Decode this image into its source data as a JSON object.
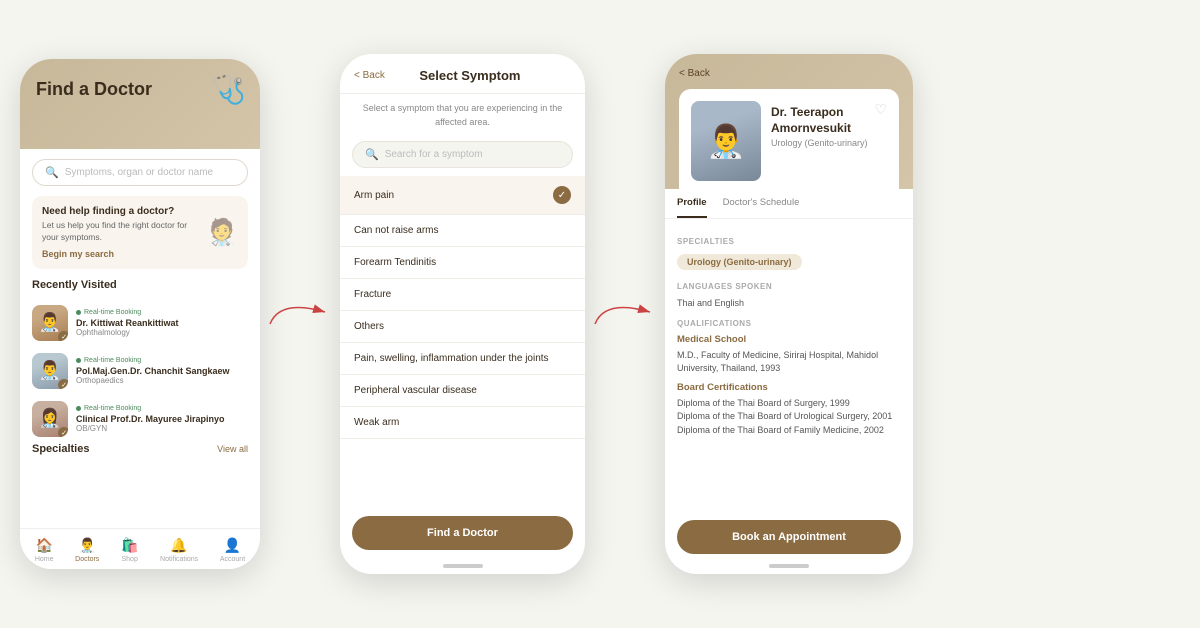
{
  "screen1": {
    "title": "Find a Doctor",
    "search_placeholder": "Symptoms, organ or doctor name",
    "stethoscope": "🩺",
    "help_card": {
      "title": "Need help finding a doctor?",
      "description": "Let us help you find the right doctor for your symptoms.",
      "link": "Begin my search"
    },
    "recently_visited_label": "Recently Visited",
    "doctors": [
      {
        "name": "Dr. Kittiwat Reankittiwat",
        "specialty": "Ophthalmology",
        "badge": "Real-time Booking"
      },
      {
        "name": "Pol.Maj.Gen.Dr. Chanchit Sangkaew",
        "specialty": "Orthopaedics",
        "badge": "Real-time Booking"
      },
      {
        "name": "Clinical Prof.Dr. Mayuree Jirapinyo",
        "specialty": "OB/GYN",
        "badge": "Real-time Booking"
      }
    ],
    "specialties_label": "Specialties",
    "view_all": "View all",
    "nav": {
      "home": "Home",
      "doctors": "Doctors",
      "shop": "Shop",
      "notifications": "Notifications",
      "account": "Account"
    }
  },
  "screen2": {
    "back_label": "< Back",
    "title": "Select Symptom",
    "subtitle": "Select a symptom that you are experiencing in the affected area.",
    "search_placeholder": "Search for a symptom",
    "symptoms": [
      {
        "name": "Arm pain",
        "selected": true
      },
      {
        "name": "Can not raise arms",
        "selected": false
      },
      {
        "name": "Forearm Tendinitis",
        "selected": false
      },
      {
        "name": "Fracture",
        "selected": false
      },
      {
        "name": "Others",
        "selected": false
      },
      {
        "name": "Pain, swelling, inflammation under the joints",
        "selected": false
      },
      {
        "name": "Peripheral vascular disease",
        "selected": false
      },
      {
        "name": "Weak arm",
        "selected": false
      }
    ],
    "find_doctor_btn": "Find a Doctor"
  },
  "screen3": {
    "back_label": "< Back",
    "doctor": {
      "name": "Dr. Teerapon Amornvesukit",
      "specialty": "Urology (Genito-urinary)"
    },
    "tabs": [
      "Profile",
      "Doctor's Schedule"
    ],
    "active_tab": "Profile",
    "specialties_label": "SPECIALTIES",
    "specialty_badge": "Urology (Genito-urinary)",
    "languages_label": "LANGUAGES SPOKEN",
    "languages": "Thai and English",
    "qualifications_label": "QUALIFICATIONS",
    "medical_school_title": "Medical School",
    "medical_school_detail": "M.D., Faculty of Medicine, Siriraj Hospital, Mahidol University, Thailand, 1993",
    "board_cert_title": "Board Certifications",
    "board_cert_1": "Diploma of the Thai Board of Surgery, 1999",
    "board_cert_2": "Diploma of the Thai Board of Urological Surgery, 2001",
    "board_cert_3": "Diploma of the Thai Board of Family Medicine, 2002",
    "book_btn": "Book an Appointment"
  },
  "arrows": {
    "arrow1": "→",
    "arrow2": "→"
  }
}
